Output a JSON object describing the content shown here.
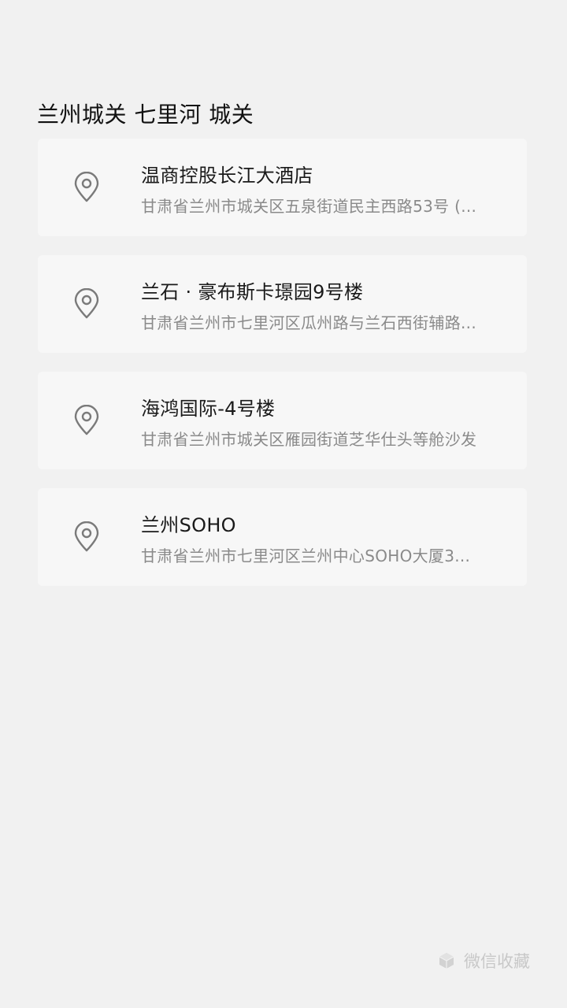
{
  "section": {
    "title": "兰州城关 七里河 城关"
  },
  "places": [
    {
      "name": "温商控股长江大酒店",
      "address": "甘肃省兰州市城关区五泉街道民主西路53号 (...",
      "icon": "location-pin-icon"
    },
    {
      "name": "兰石 · 豪布斯卡璟园9号楼",
      "address": "甘肃省兰州市七里河区瓜州路与兰石西街辅路...",
      "icon": "location-pin-icon"
    },
    {
      "name": "海鸿国际-4号楼",
      "address": "甘肃省兰州市城关区雁园街道芝华仕头等舱沙发",
      "icon": "location-pin-icon"
    },
    {
      "name": "兰州SOHO",
      "address": "甘肃省兰州市七里河区兰州中心SOHO大厦3...",
      "icon": "location-pin-icon"
    }
  ],
  "footer": {
    "label": "微信收藏",
    "icon": "cube-icon"
  },
  "colors": {
    "background": "#f1f1f1",
    "card": "#f7f7f7",
    "title_text": "#111111",
    "secondary_text": "#8a8a8a",
    "icon_stroke": "#7a7a7a",
    "footer_text": "#c8c8c8"
  }
}
